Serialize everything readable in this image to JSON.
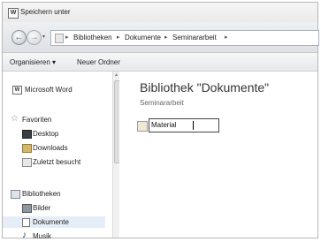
{
  "window": {
    "app_icon_letter": "W",
    "title": "Speichern unter"
  },
  "nav": {
    "history_arrow": "▾",
    "breadcrumbs": [
      "Bibliotheken",
      "Dokumente",
      "Seminararbeit"
    ]
  },
  "toolbar": {
    "organize_label": "Organisieren ▾",
    "new_folder_label": "Neuer Ordner"
  },
  "sidebar": {
    "items": [
      {
        "label": "Microsoft Word",
        "icon": "word-icon"
      },
      {
        "label": "Favoriten",
        "icon": "star-icon"
      },
      {
        "label": "Desktop",
        "icon": "desktop-icon"
      },
      {
        "label": "Downloads",
        "icon": "downloads-icon"
      },
      {
        "label": "Zuletzt besucht",
        "icon": "recent-places-icon"
      },
      {
        "label": "Bibliotheken",
        "icon": "libraries-icon"
      },
      {
        "label": "Bilder",
        "icon": "pictures-icon"
      },
      {
        "label": "Dokumente",
        "icon": "documents-icon"
      },
      {
        "label": "Musik",
        "icon": "music-icon"
      }
    ]
  },
  "main": {
    "library_title": "Bibliothek \"Dokumente\"",
    "library_subtitle": "Seminararbeit",
    "rename_value": "Material"
  }
}
